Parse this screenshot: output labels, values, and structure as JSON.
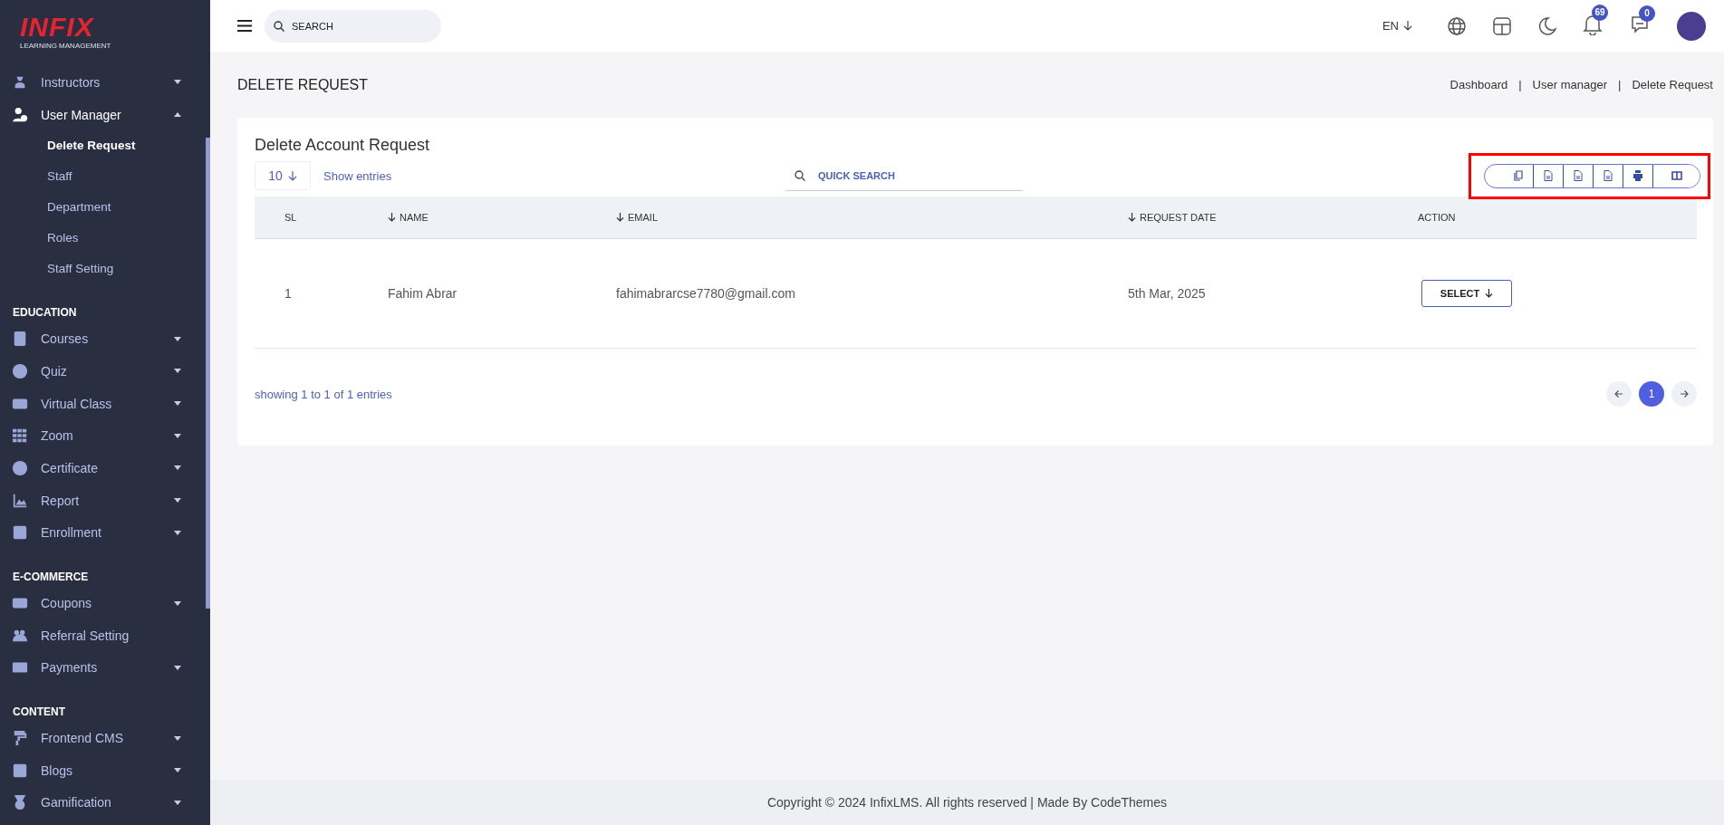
{
  "logo": {
    "wordmark": "INFIX",
    "tagline": "LEARNING MANAGEMENT"
  },
  "sidebar": {
    "sections": [
      {
        "items": [
          {
            "label": "Instructors",
            "kind": "menu",
            "expanded": false
          },
          {
            "label": "User Manager",
            "kind": "menu",
            "expanded": true,
            "children": [
              {
                "label": "Delete Request",
                "selected": true
              },
              {
                "label": "Staff",
                "selected": false
              },
              {
                "label": "Department",
                "selected": false
              },
              {
                "label": "Roles",
                "selected": false
              },
              {
                "label": "Staff Setting",
                "selected": false
              }
            ]
          }
        ]
      },
      {
        "title": "EDUCATION",
        "items": [
          {
            "label": "Courses",
            "kind": "menu",
            "expanded": false
          },
          {
            "label": "Quiz",
            "kind": "menu",
            "expanded": false
          },
          {
            "label": "Virtual Class",
            "kind": "menu",
            "expanded": false
          },
          {
            "label": "Zoom",
            "kind": "menu",
            "expanded": false
          },
          {
            "label": "Certificate",
            "kind": "menu",
            "expanded": false
          },
          {
            "label": "Report",
            "kind": "menu",
            "expanded": false
          },
          {
            "label": "Enrollment",
            "kind": "menu",
            "expanded": false
          }
        ]
      },
      {
        "title": "E-COMMERCE",
        "items": [
          {
            "label": "Coupons",
            "kind": "menu",
            "expanded": false
          },
          {
            "label": "Referral Setting",
            "kind": "link",
            "expanded": false
          },
          {
            "label": "Payments",
            "kind": "menu",
            "expanded": false
          }
        ]
      },
      {
        "title": "CONTENT",
        "items": [
          {
            "label": "Frontend CMS",
            "kind": "menu",
            "expanded": false
          },
          {
            "label": "Blogs",
            "kind": "menu",
            "expanded": false
          },
          {
            "label": "Gamification",
            "kind": "menu",
            "expanded": false
          }
        ]
      }
    ]
  },
  "topbar": {
    "search_placeholder": "SEARCH",
    "language": "EN",
    "notifications_badge": "69",
    "messages_badge": "0"
  },
  "page": {
    "title": "DELETE REQUEST",
    "breadcrumb": [
      "Dashboard",
      "User manager",
      "Delete Request"
    ],
    "breadcrumb_separator": "|"
  },
  "card": {
    "title": "Delete Account Request",
    "entries": "10",
    "entries_label": "Show entries",
    "search_placeholder": "QUICK SEARCH",
    "columns": [
      {
        "label": "SL",
        "sortable": false
      },
      {
        "label": "NAME",
        "sortable": true
      },
      {
        "label": "EMAIL",
        "sortable": true
      },
      {
        "label": "REQUEST DATE",
        "sortable": true
      },
      {
        "label": "ACTION",
        "sortable": false
      }
    ],
    "rows": [
      {
        "cells": [
          "1",
          "Fahim Abrar",
          "fahimabrarcse7780@gmail.com",
          "5th Mar, 2025"
        ],
        "action": "SELECT"
      }
    ],
    "summary": "showing 1 to 1 of 1 entries",
    "pages": [
      {
        "label": "1",
        "selected": true
      }
    ]
  },
  "footer": "Copyright © 2024 InfixLMS. All rights reserved | Made By CodeThemes"
}
